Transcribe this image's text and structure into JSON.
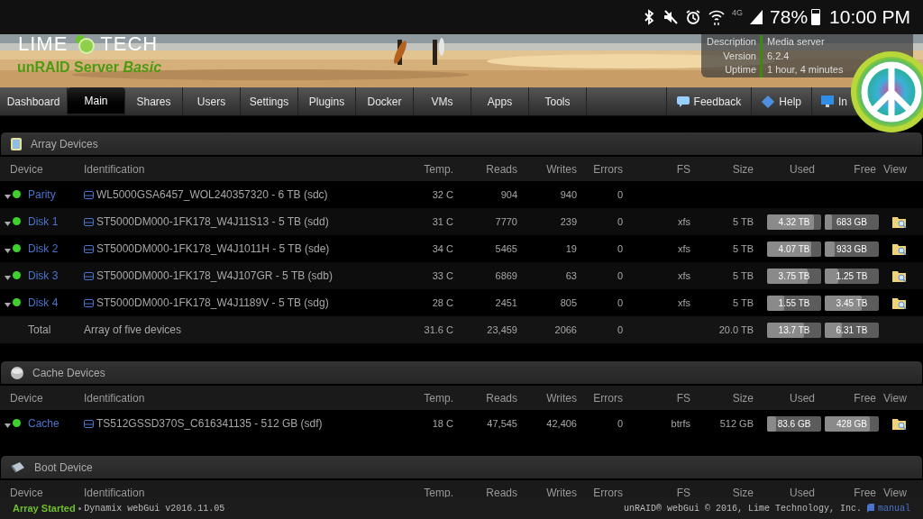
{
  "phone_status": {
    "network": "4G",
    "battery": "78%",
    "time": "10:00 PM"
  },
  "header": {
    "logo_left": "LIME",
    "logo_right": "TECH",
    "server_title": "unRAID Server *Basic*",
    "info": [
      {
        "label": "Description",
        "value": "Media server"
      },
      {
        "label": "Version",
        "value": "6.2.4"
      },
      {
        "label": "Uptime",
        "value": "1 hour, 4 minutes"
      }
    ]
  },
  "nav": {
    "tabs": [
      {
        "label": "Dashboard",
        "selected": false
      },
      {
        "label": "Main",
        "selected": true
      },
      {
        "label": "Shares",
        "selected": false
      },
      {
        "label": "Users",
        "selected": false
      },
      {
        "label": "Settings",
        "selected": false
      },
      {
        "label": "Plugins",
        "selected": false
      },
      {
        "label": "Docker",
        "selected": false
      },
      {
        "label": "VMs",
        "selected": false
      },
      {
        "label": "Apps",
        "selected": false
      },
      {
        "label": "Tools",
        "selected": false
      }
    ],
    "actions": [
      {
        "kind": "feedback",
        "label": "Feedback"
      },
      {
        "kind": "help",
        "label": "Help"
      },
      {
        "kind": "info",
        "label": "In"
      }
    ]
  },
  "sections": [
    {
      "kind": "array",
      "title": "Array Devices",
      "columns": [
        "Device",
        "Identification",
        "Temp.",
        "Reads",
        "Writes",
        "Errors",
        "FS",
        "Size",
        "Used",
        "Free",
        "View"
      ],
      "rows": [
        {
          "kind": "device",
          "name": "Parity",
          "color": "#3fcf2f",
          "identification": "WL5000GSA6457_WOL240357320 - 6 TB (sdc)",
          "temp": "32 C",
          "reads": "904",
          "writes": "940",
          "errors": "0",
          "view": false
        },
        {
          "kind": "device",
          "name": "Disk 1",
          "color": "#3fcf2f",
          "identification": "ST5000DM000-1FK178_W4J11S13 - 5 TB (sdd)",
          "temp": "31 C",
          "reads": "7770",
          "writes": "239",
          "errors": "0",
          "fs": "xfs",
          "size": "5 TB",
          "used": {
            "text": "4.32 TB",
            "level": 0.86
          },
          "free": {
            "text": "683 GB",
            "level": 0.14
          },
          "view": true
        },
        {
          "kind": "device",
          "name": "Disk 2",
          "color": "#3fcf2f",
          "identification": "ST5000DM000-1FK178_W4J1011H - 5 TB (sde)",
          "temp": "34 C",
          "reads": "5465",
          "writes": "19",
          "errors": "0",
          "fs": "xfs",
          "size": "5 TB",
          "used": {
            "text": "4.07 TB",
            "level": 0.81
          },
          "free": {
            "text": "933 GB",
            "level": 0.19
          },
          "view": true
        },
        {
          "kind": "device",
          "name": "Disk 3",
          "color": "#3fcf2f",
          "identification": "ST5000DM000-1FK178_W4J107GR - 5 TB (sdb)",
          "temp": "33 C",
          "reads": "6869",
          "writes": "63",
          "errors": "0",
          "fs": "xfs",
          "size": "5 TB",
          "used": {
            "text": "3.75 TB",
            "level": 0.75
          },
          "free": {
            "text": "1.25 TB",
            "level": 0.25
          },
          "view": true
        },
        {
          "kind": "device",
          "name": "Disk 4",
          "color": "#3fcf2f",
          "identification": "ST5000DM000-1FK178_W4J1189V - 5 TB (sdg)",
          "temp": "28 C",
          "reads": "2451",
          "writes": "805",
          "errors": "0",
          "fs": "xfs",
          "size": "5 TB",
          "used": {
            "text": "1.55 TB",
            "level": 0.31
          },
          "free": {
            "text": "3.45 TB",
            "level": 0.69
          },
          "view": true
        },
        {
          "kind": "total",
          "name": "Total",
          "identification": "Array of five devices",
          "temp": "31.6 C",
          "reads": "23,459",
          "writes": "2066",
          "errors": "0",
          "size": "20.0 TB",
          "used": {
            "text": "13.7 TB",
            "level": 0.69
          },
          "free": {
            "text": "6.31 TB",
            "level": 0.31
          },
          "view": false
        }
      ]
    },
    {
      "kind": "cache",
      "title": "Cache Devices",
      "columns": [
        "Device",
        "Identification",
        "Temp.",
        "Reads",
        "Writes",
        "Errors",
        "FS",
        "Size",
        "Used",
        "Free",
        "View"
      ],
      "rows": [
        {
          "kind": "device",
          "name": "Cache",
          "color": "#3fcf2f",
          "identification": "TS512GSSD370S_C616341135 - 512 GB (sdf)",
          "temp": "18 C",
          "reads": "47,545",
          "writes": "42,406",
          "errors": "0",
          "fs": "btrfs",
          "size": "512 GB",
          "used": {
            "text": "83.6 GB",
            "level": 0.16
          },
          "free": {
            "text": "428 GB",
            "level": 0.84
          },
          "view": true
        }
      ]
    },
    {
      "kind": "boot",
      "title": "Boot Device",
      "columns": [
        "Device",
        "Identification",
        "Temp.",
        "Reads",
        "Writes",
        "Errors",
        "FS",
        "Size",
        "Used",
        "Free",
        "View"
      ]
    }
  ],
  "footer": {
    "status": "Array Started",
    "bullet": "•",
    "version": "Dynamix webGui v2016.11.05",
    "copyright": "unRAID® webGui © 2016, Lime Technology, Inc.",
    "manual": "manual"
  }
}
